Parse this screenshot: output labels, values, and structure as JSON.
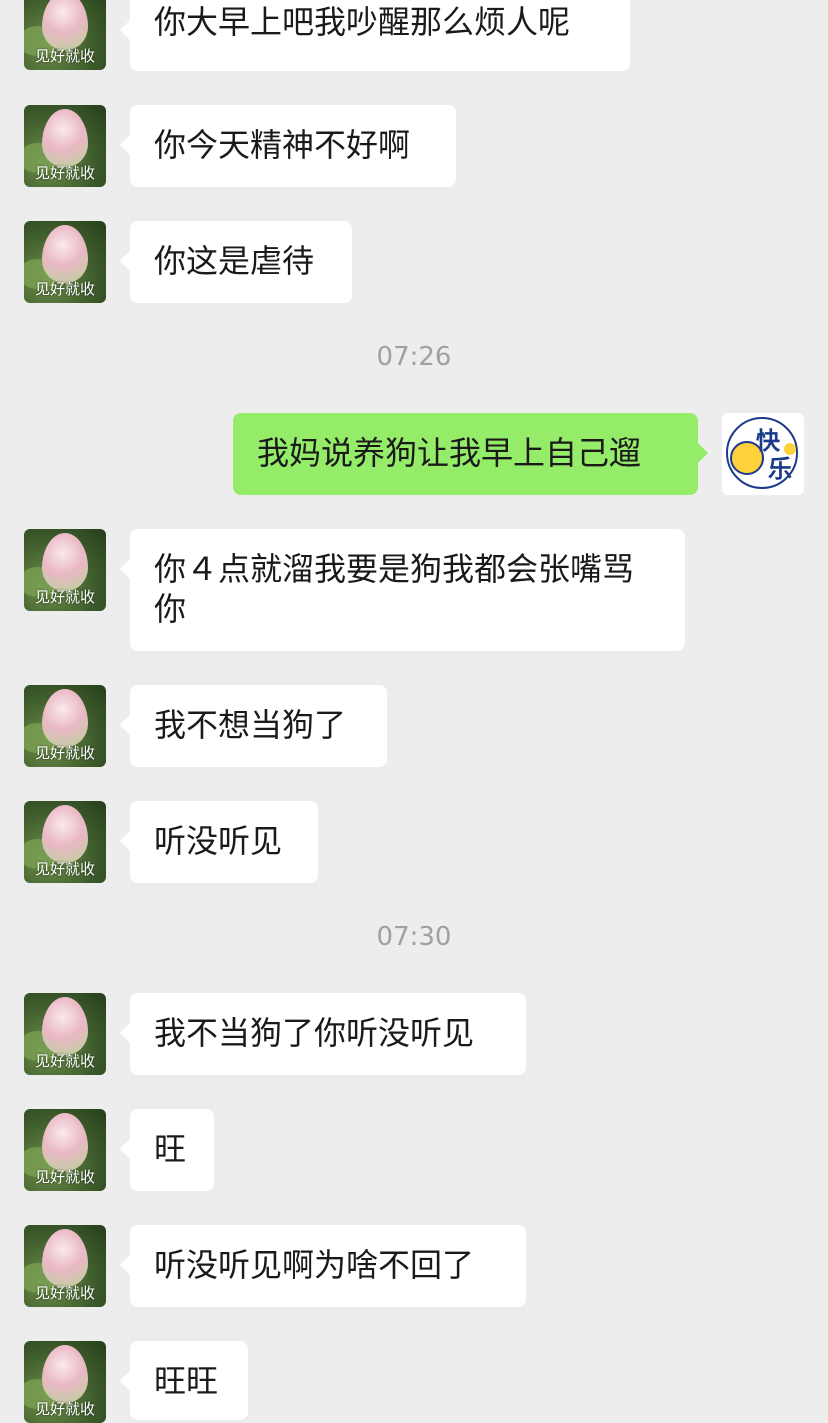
{
  "contact": {
    "avatar_caption": "见好就收"
  },
  "timestamps": {
    "t1": "07:26",
    "t2": "07:30"
  },
  "messages": {
    "m1": "你大早上吧我吵醒那么烦人呢",
    "m2": "你今天精神不好啊",
    "m3": "你这是虐待",
    "m4": "我妈说养狗让我早上自己遛",
    "m5": "你４点就溜我要是狗我都会张嘴骂\n你",
    "m6": "我不想当狗了",
    "m7": "听没听见",
    "m8": "我不当狗了你听没听见",
    "m9": "旺",
    "m10": "听没听见啊为啥不回了",
    "m11": "旺旺"
  },
  "self_avatar": {
    "line1": "快",
    "line2": "乐"
  },
  "colors": {
    "background": "#ededed",
    "incoming_bubble": "#ffffff",
    "outgoing_bubble": "#95ec69",
    "timestamp": "#a0a0a0"
  }
}
